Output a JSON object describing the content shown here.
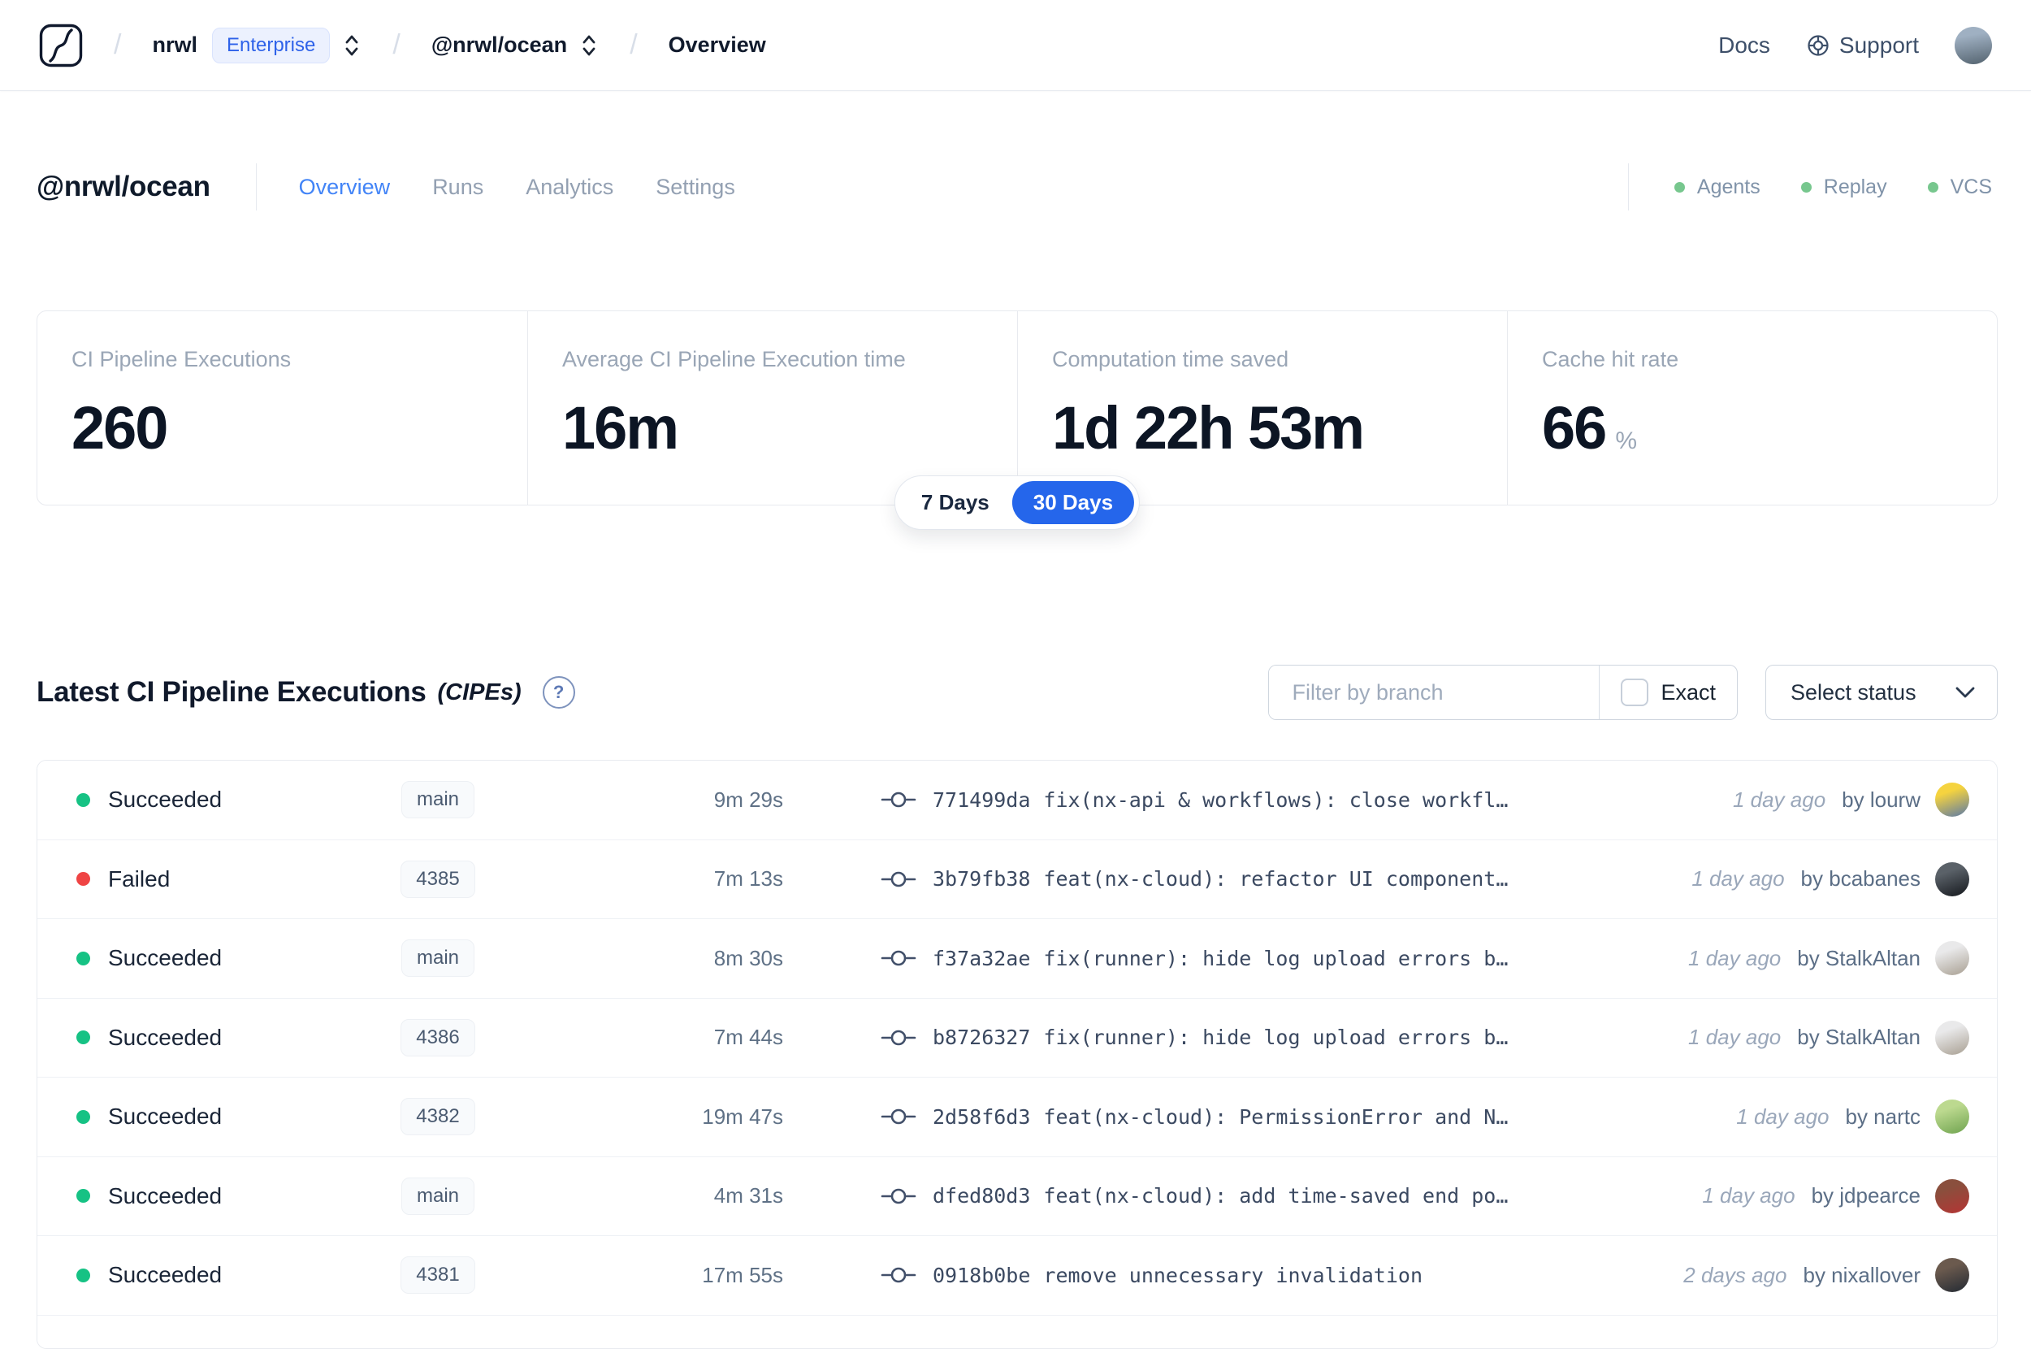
{
  "colors": {
    "accent_blue": "#2566eb",
    "active_tab_blue": "#4284f7",
    "succeeded": "#16c284",
    "failed": "#ef4444",
    "indicator_green": "#77c78e",
    "enterprise_badge_blue": "#2e62e9"
  },
  "navbar": {
    "breadcrumb": {
      "separator": "/",
      "org": "nrwl",
      "org_badge": "Enterprise",
      "workspace": "@nrwl/ocean",
      "page": "Overview"
    },
    "links": {
      "docs": "Docs",
      "support": "Support"
    },
    "user_avatar_colors": [
      "#9fb0c2",
      "#54636f"
    ]
  },
  "workspace_header": {
    "title": "@nrwl/ocean",
    "tabs": [
      {
        "label": "Overview",
        "active": true
      },
      {
        "label": "Runs",
        "active": false
      },
      {
        "label": "Analytics",
        "active": false
      },
      {
        "label": "Settings",
        "active": false
      }
    ],
    "indicators": [
      {
        "label": "Agents"
      },
      {
        "label": "Replay"
      },
      {
        "label": "VCS"
      }
    ]
  },
  "stats": {
    "cards": [
      {
        "label": "CI Pipeline Executions",
        "value": "260",
        "suffix": ""
      },
      {
        "label": "Average CI Pipeline Execution time",
        "value": "16m",
        "suffix": ""
      },
      {
        "label": "Computation time saved",
        "value": "1d 22h 53m",
        "suffix": ""
      },
      {
        "label": "Cache hit rate",
        "value": "66",
        "suffix": "%"
      }
    ],
    "periods": [
      {
        "label": "7 Days"
      },
      {
        "label": "30 Days"
      }
    ],
    "selected_period": "30 Days"
  },
  "cipe_section": {
    "title": "Latest CI Pipeline Executions",
    "title_suffix": "(CIPEs)",
    "help_glyph": "?",
    "filter": {
      "placeholder": "Filter by branch",
      "exact_label": "Exact",
      "exact_checked": false,
      "status_button": "Select status"
    },
    "rows": [
      {
        "status": "Succeeded",
        "branch": "main",
        "duration": "9m 29s",
        "commit": "771499da",
        "message": "fix(nx-api & workflows): close workfl…",
        "time": "1 day ago",
        "author": "by lourw",
        "avatar_colors": [
          "#f5d33f",
          "#5b79a8"
        ]
      },
      {
        "status": "Failed",
        "branch": "4385",
        "duration": "7m 13s",
        "commit": "3b79fb38",
        "message": "feat(nx-cloud): refactor UI component…",
        "time": "1 day ago",
        "author": "by bcabanes",
        "avatar_colors": [
          "#5a6168",
          "#15181d"
        ]
      },
      {
        "status": "Succeeded",
        "branch": "main",
        "duration": "8m 30s",
        "commit": "f37a32ae",
        "message": "fix(runner): hide log upload errors b…",
        "time": "1 day ago",
        "author": "by StalkAltan",
        "avatar_colors": [
          "#e9e9ea",
          "#a89f92"
        ]
      },
      {
        "status": "Succeeded",
        "branch": "4386",
        "duration": "7m 44s",
        "commit": "b8726327",
        "message": "fix(runner): hide log upload errors b…",
        "time": "1 day ago",
        "author": "by StalkAltan",
        "avatar_colors": [
          "#e9e9ea",
          "#a89f92"
        ]
      },
      {
        "status": "Succeeded",
        "branch": "4382",
        "duration": "19m 47s",
        "commit": "2d58f6d3",
        "message": "feat(nx-cloud): PermissionError and N…",
        "time": "1 day ago",
        "author": "by nartc",
        "avatar_colors": [
          "#bcd98f",
          "#6fa34f"
        ]
      },
      {
        "status": "Succeeded",
        "branch": "main",
        "duration": "4m 31s",
        "commit": "dfed80d3",
        "message": "feat(nx-cloud): add time-saved end po…",
        "time": "1 day ago",
        "author": "by jdpearce",
        "avatar_colors": [
          "#8a4f3d",
          "#b53434"
        ]
      },
      {
        "status": "Succeeded",
        "branch": "4381",
        "duration": "17m 55s",
        "commit": "0918b0be",
        "message": "remove unnecessary invalidation",
        "time": "2 days ago",
        "author": "by nixallover",
        "avatar_colors": [
          "#6b5a4e",
          "#232a33"
        ]
      }
    ]
  }
}
